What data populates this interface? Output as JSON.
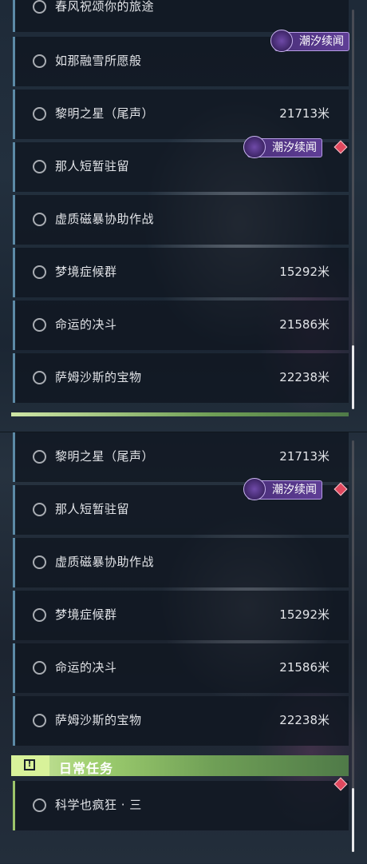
{
  "panel_a": {
    "rows": [
      {
        "title": "春风祝颂你的旅途",
        "distance": ""
      },
      {
        "title": "如那融雪所愿般",
        "distance": ""
      },
      {
        "title": "黎明之星（尾声）",
        "distance": "21713米"
      },
      {
        "title": "那人短暂驻留",
        "distance": ""
      },
      {
        "title": "虚质磁暴协助作战",
        "distance": ""
      },
      {
        "title": "梦境症候群",
        "distance": "15292米"
      },
      {
        "title": "命运的决斗",
        "distance": "21586米"
      },
      {
        "title": "萨姆沙斯的宝物",
        "distance": "22238米"
      }
    ],
    "tags": [
      {
        "label": "潮汐续闻",
        "icon": "tidal-sparkle-icon"
      },
      {
        "label": "潮汐续闻",
        "icon": "tidal-sparkle-icon"
      }
    ]
  },
  "panel_b": {
    "rows": [
      {
        "title": "黎明之星（尾声）",
        "distance": "21713米"
      },
      {
        "title": "那人短暂驻留",
        "distance": ""
      },
      {
        "title": "虚质磁暴协助作战",
        "distance": ""
      },
      {
        "title": "梦境症候群",
        "distance": "15292米"
      },
      {
        "title": "命运的决斗",
        "distance": "21586米"
      },
      {
        "title": "萨姆沙斯的宝物",
        "distance": "22238米"
      }
    ],
    "tags": [
      {
        "label": "潮汐续闻",
        "icon": "tidal-sparkle-icon"
      }
    ],
    "section": {
      "label": "日常任务",
      "icon": "exclamation-box-icon"
    },
    "daily_rows": [
      {
        "title": "科学也疯狂 · 三",
        "distance": ""
      }
    ]
  },
  "colors": {
    "quest_accent": "#5c8aa6",
    "daily_accent": "#9cc46a",
    "tag_purple": "#5f3e96",
    "alert_red": "#e0485e"
  }
}
